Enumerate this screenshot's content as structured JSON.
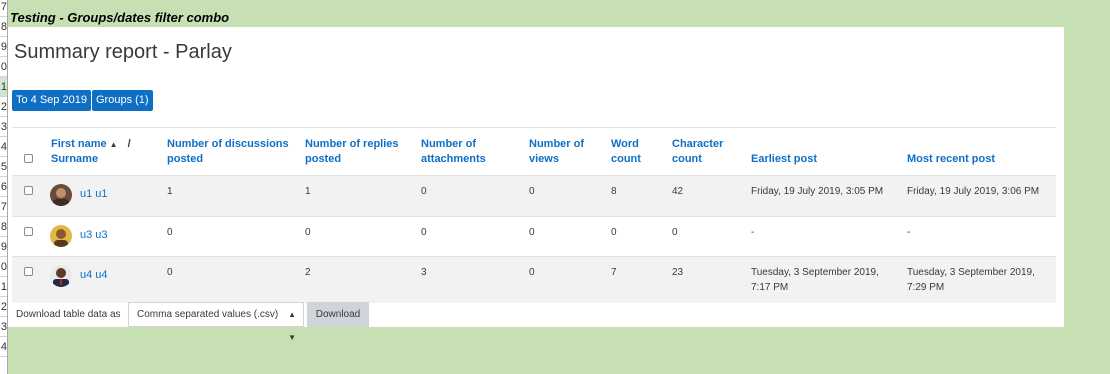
{
  "sheet": {
    "title": "Testing - Groups/dates filter combo",
    "row_numbers": [
      "7",
      "8",
      "9",
      "0",
      "1",
      "2",
      "3",
      "4",
      "5",
      "6",
      "7",
      "8",
      "9",
      "0",
      "1",
      "2",
      "3",
      "4"
    ]
  },
  "report": {
    "title": "Summary report - Parlay",
    "filters": {
      "date_label": "To 4 Sep 2019",
      "groups_label": "Groups (1)"
    },
    "columns": {
      "first_name": "First name",
      "separator": "/",
      "surname": "Surname",
      "discussions": [
        "Number of discussions",
        "posted"
      ],
      "replies": [
        "Number of replies",
        "posted"
      ],
      "attachments": [
        "Number of",
        "attachments"
      ],
      "views": [
        "Number of",
        "views"
      ],
      "words": [
        "Word",
        "count"
      ],
      "characters": [
        "Character",
        "count"
      ],
      "earliest": "Earliest post",
      "recent": "Most recent post"
    },
    "rows": [
      {
        "user": "u1 u1",
        "discussions": "1",
        "replies": "1",
        "attachments": "0",
        "views": "0",
        "words": "8",
        "characters": "42",
        "earliest": [
          "Friday, 19 July 2019, 3:05 PM"
        ],
        "recent": [
          "Friday, 19 July 2019, 3:06 PM"
        ]
      },
      {
        "user": "u3 u3",
        "discussions": "0",
        "replies": "0",
        "attachments": "0",
        "views": "0",
        "words": "0",
        "characters": "0",
        "earliest": [
          "-"
        ],
        "recent": [
          "-"
        ]
      },
      {
        "user": "u4 u4",
        "discussions": "0",
        "replies": "2",
        "attachments": "3",
        "views": "0",
        "words": "7",
        "characters": "23",
        "earliest": [
          "Tuesday, 3 September 2019,",
          "7:17 PM"
        ],
        "recent": [
          "Tuesday, 3 September 2019,",
          "7:29 PM"
        ]
      }
    ],
    "download": {
      "label": "Download table data as",
      "format": "Comma separated values (.csv)",
      "button": "Download"
    }
  },
  "colors": {
    "background": "#c6e0b4",
    "accent": "#0f6fc5",
    "row_stripe": "#f2f2f2"
  },
  "icons": [
    "sort-ascending-icon",
    "select-chevron-icon"
  ]
}
